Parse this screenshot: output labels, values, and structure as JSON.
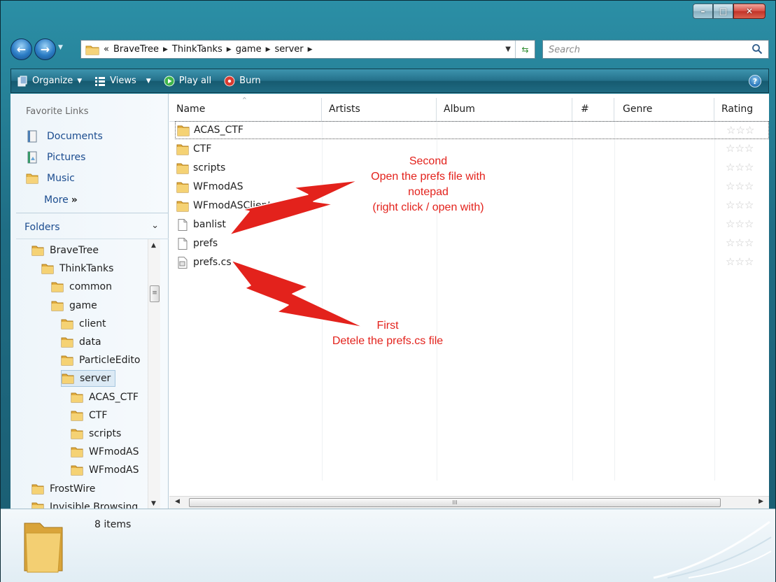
{
  "window": {
    "caption_buttons": {
      "minimize": "–",
      "maximize": "□",
      "close": "✕"
    }
  },
  "navigation": {
    "breadcrumb_prefix": "«",
    "breadcrumbs": [
      "BraveTree",
      "ThinkTanks",
      "game",
      "server"
    ],
    "search_placeholder": "Search"
  },
  "command_bar": {
    "organize": "Organize",
    "views": "Views",
    "play_all": "Play all",
    "burn": "Burn",
    "help": "?"
  },
  "nav_pane": {
    "favorite_links_heading": "Favorite Links",
    "favorite_links": [
      {
        "label": "Documents",
        "icon": "documents-icon"
      },
      {
        "label": "Pictures",
        "icon": "pictures-icon"
      },
      {
        "label": "Music",
        "icon": "music-icon"
      }
    ],
    "more": "More",
    "more_chevron": "»",
    "folders_heading": "Folders",
    "folders_chevron": "⌄",
    "tree": [
      {
        "label": "BraveTree",
        "depth": 0
      },
      {
        "label": "ThinkTanks",
        "depth": 1
      },
      {
        "label": "common",
        "depth": 2
      },
      {
        "label": "game",
        "depth": 2
      },
      {
        "label": "client",
        "depth": 3
      },
      {
        "label": "data",
        "depth": 3
      },
      {
        "label": "ParticleEdito",
        "depth": 3
      },
      {
        "label": "server",
        "depth": 3,
        "selected": true
      },
      {
        "label": "ACAS_CTF",
        "depth": 4
      },
      {
        "label": "CTF",
        "depth": 4
      },
      {
        "label": "scripts",
        "depth": 4
      },
      {
        "label": "WFmodAS",
        "depth": 4
      },
      {
        "label": "WFmodAS",
        "depth": 4
      },
      {
        "label": "FrostWire",
        "depth": 0
      },
      {
        "label": "Invisible Browsing",
        "depth": 0
      }
    ]
  },
  "file_list": {
    "columns": [
      "Name",
      "Artists",
      "Album",
      "#",
      "Genre",
      "Rating"
    ],
    "sort_indicator": "^",
    "scroll_grip": "III",
    "files": [
      {
        "name": "ACAS_CTF",
        "type": "folder",
        "focused": true
      },
      {
        "name": "CTF",
        "type": "folder"
      },
      {
        "name": "scripts",
        "type": "folder"
      },
      {
        "name": "WFmodAS",
        "type": "folder"
      },
      {
        "name": "WFmodASClient",
        "type": "folder"
      },
      {
        "name": "banlist",
        "type": "file"
      },
      {
        "name": "prefs",
        "type": "file"
      },
      {
        "name": "prefs.cs",
        "type": "script"
      }
    ],
    "rating_stars": "☆☆☆"
  },
  "details": {
    "item_count": "8 items"
  },
  "annotations": {
    "second": [
      "Second",
      "Open the prefs file with",
      "notepad",
      "(right click / open with)"
    ],
    "first": [
      "First",
      "Detele the prefs.cs file"
    ],
    "color": "#e3221c"
  }
}
